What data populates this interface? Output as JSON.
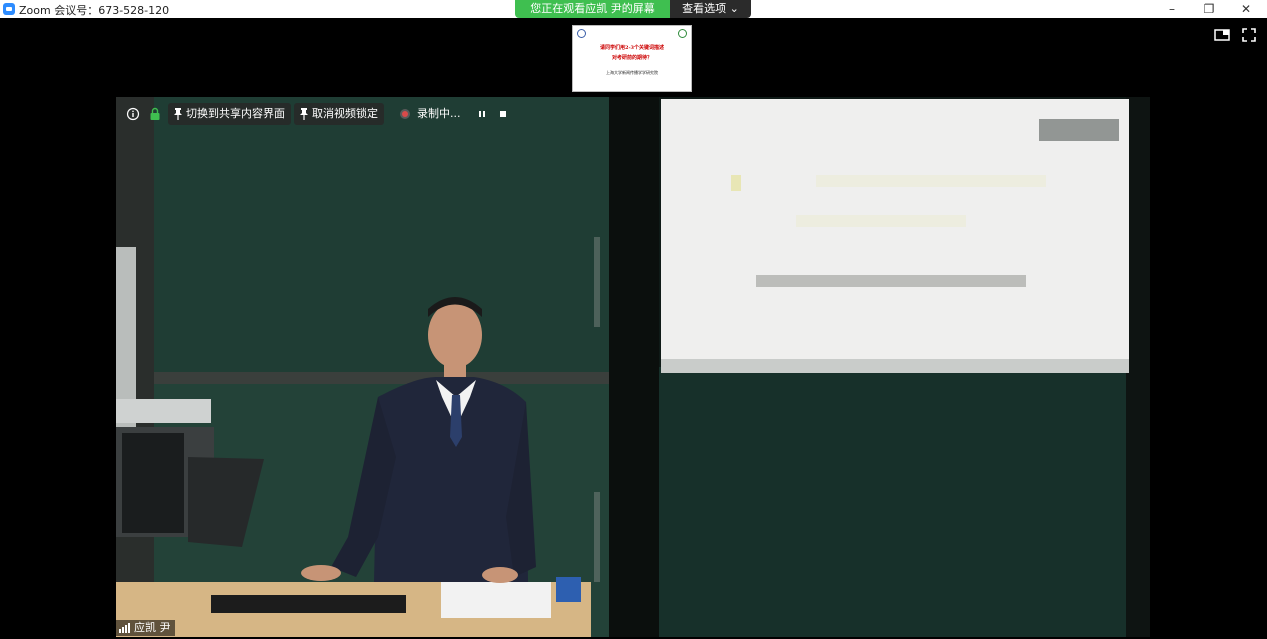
{
  "window": {
    "title": "Zoom 会议号：673-528-120",
    "minimize": "–",
    "restore": "❐",
    "close": "✕"
  },
  "share_banner": {
    "status": "您正在观看应凯 尹的屏幕",
    "options": "查看选项 ⌄"
  },
  "slide_thumbnail": {
    "line1": "请同学们用2-3个关键词描述",
    "line2": "对考研前的期待？",
    "line3": "上海大学新闻传播学学研究院"
  },
  "video_toolbar": {
    "info_icon": "info-icon",
    "lock_icon": "lock-icon",
    "switch_share": "切换到共享内容界面",
    "unlock_video": "取消视频锁定",
    "recording": "录制中...",
    "recording_color": "#d94a4a"
  },
  "participant": {
    "name": "应凯 尹"
  },
  "colors": {
    "banner_green": "#3fbf50",
    "zoom_blue": "#2d8cff",
    "chalkboard": "#1f3d34"
  }
}
